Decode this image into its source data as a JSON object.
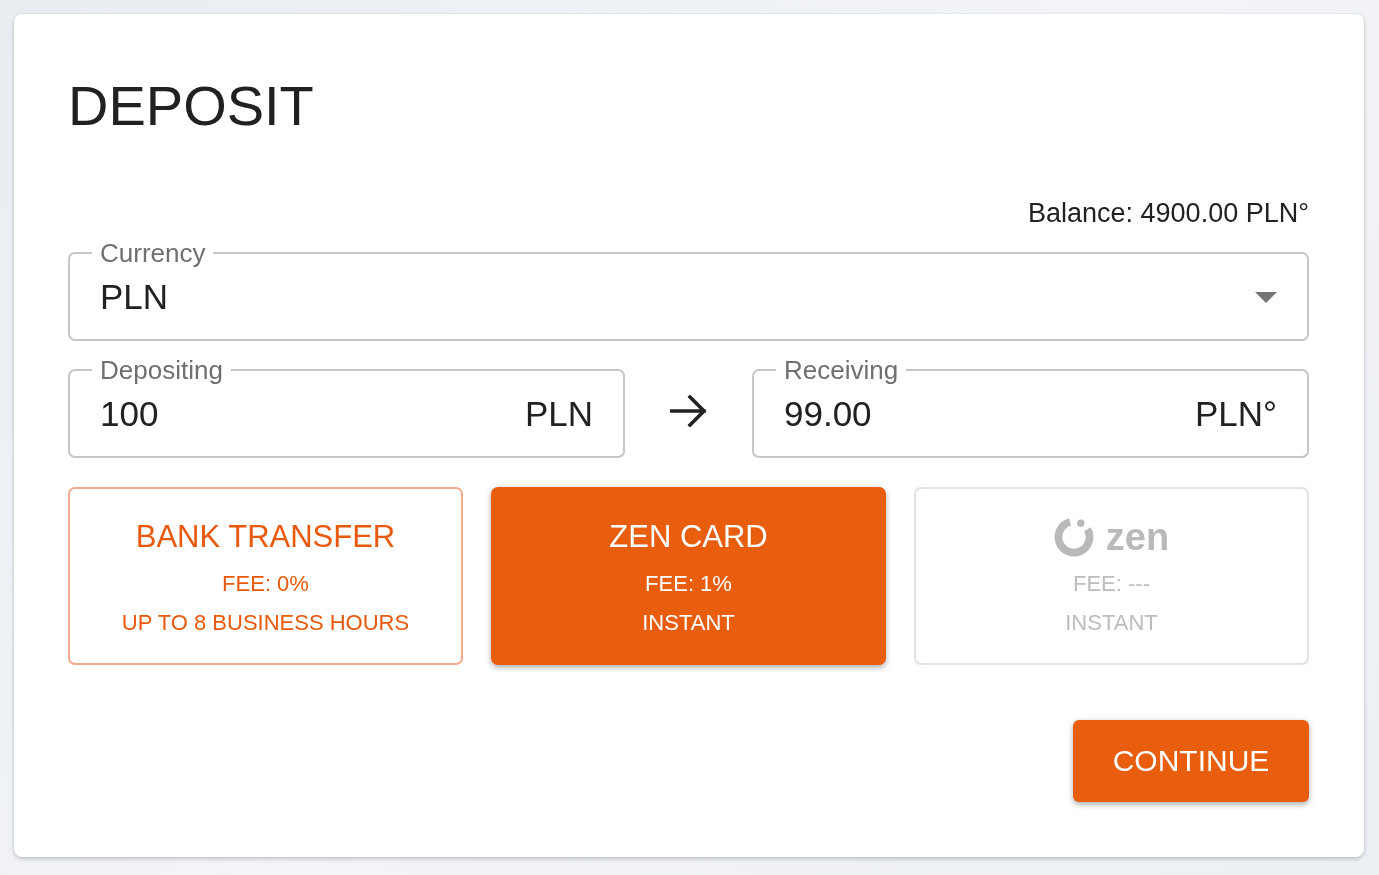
{
  "dialog": {
    "title": "DEPOSIT"
  },
  "balance": "Balance: 4900.00 PLN°",
  "currency_select": {
    "label": "Currency",
    "value": "PLN"
  },
  "amount_fields": [
    {
      "label": "Depositing",
      "value": "100",
      "unit": "PLN"
    },
    {
      "label": "Receiving",
      "value": "99.00",
      "unit": "PLN°"
    }
  ],
  "payment_methods": [
    {
      "kind": "text",
      "name": "BANK TRANSFER",
      "fee": "FEE: 0%",
      "timing": "UP TO 8 BUSINESS HOURS",
      "selected": false,
      "disabled": false
    },
    {
      "kind": "text",
      "name": "ZEN CARD",
      "fee": "FEE: 1%",
      "timing": "INSTANT",
      "selected": true,
      "disabled": false
    },
    {
      "kind": "logo",
      "name": "zen",
      "fee": "FEE: ---",
      "timing": "INSTANT",
      "selected": false,
      "disabled": true
    }
  ],
  "continue_button": {
    "label": "CONTINUE"
  }
}
